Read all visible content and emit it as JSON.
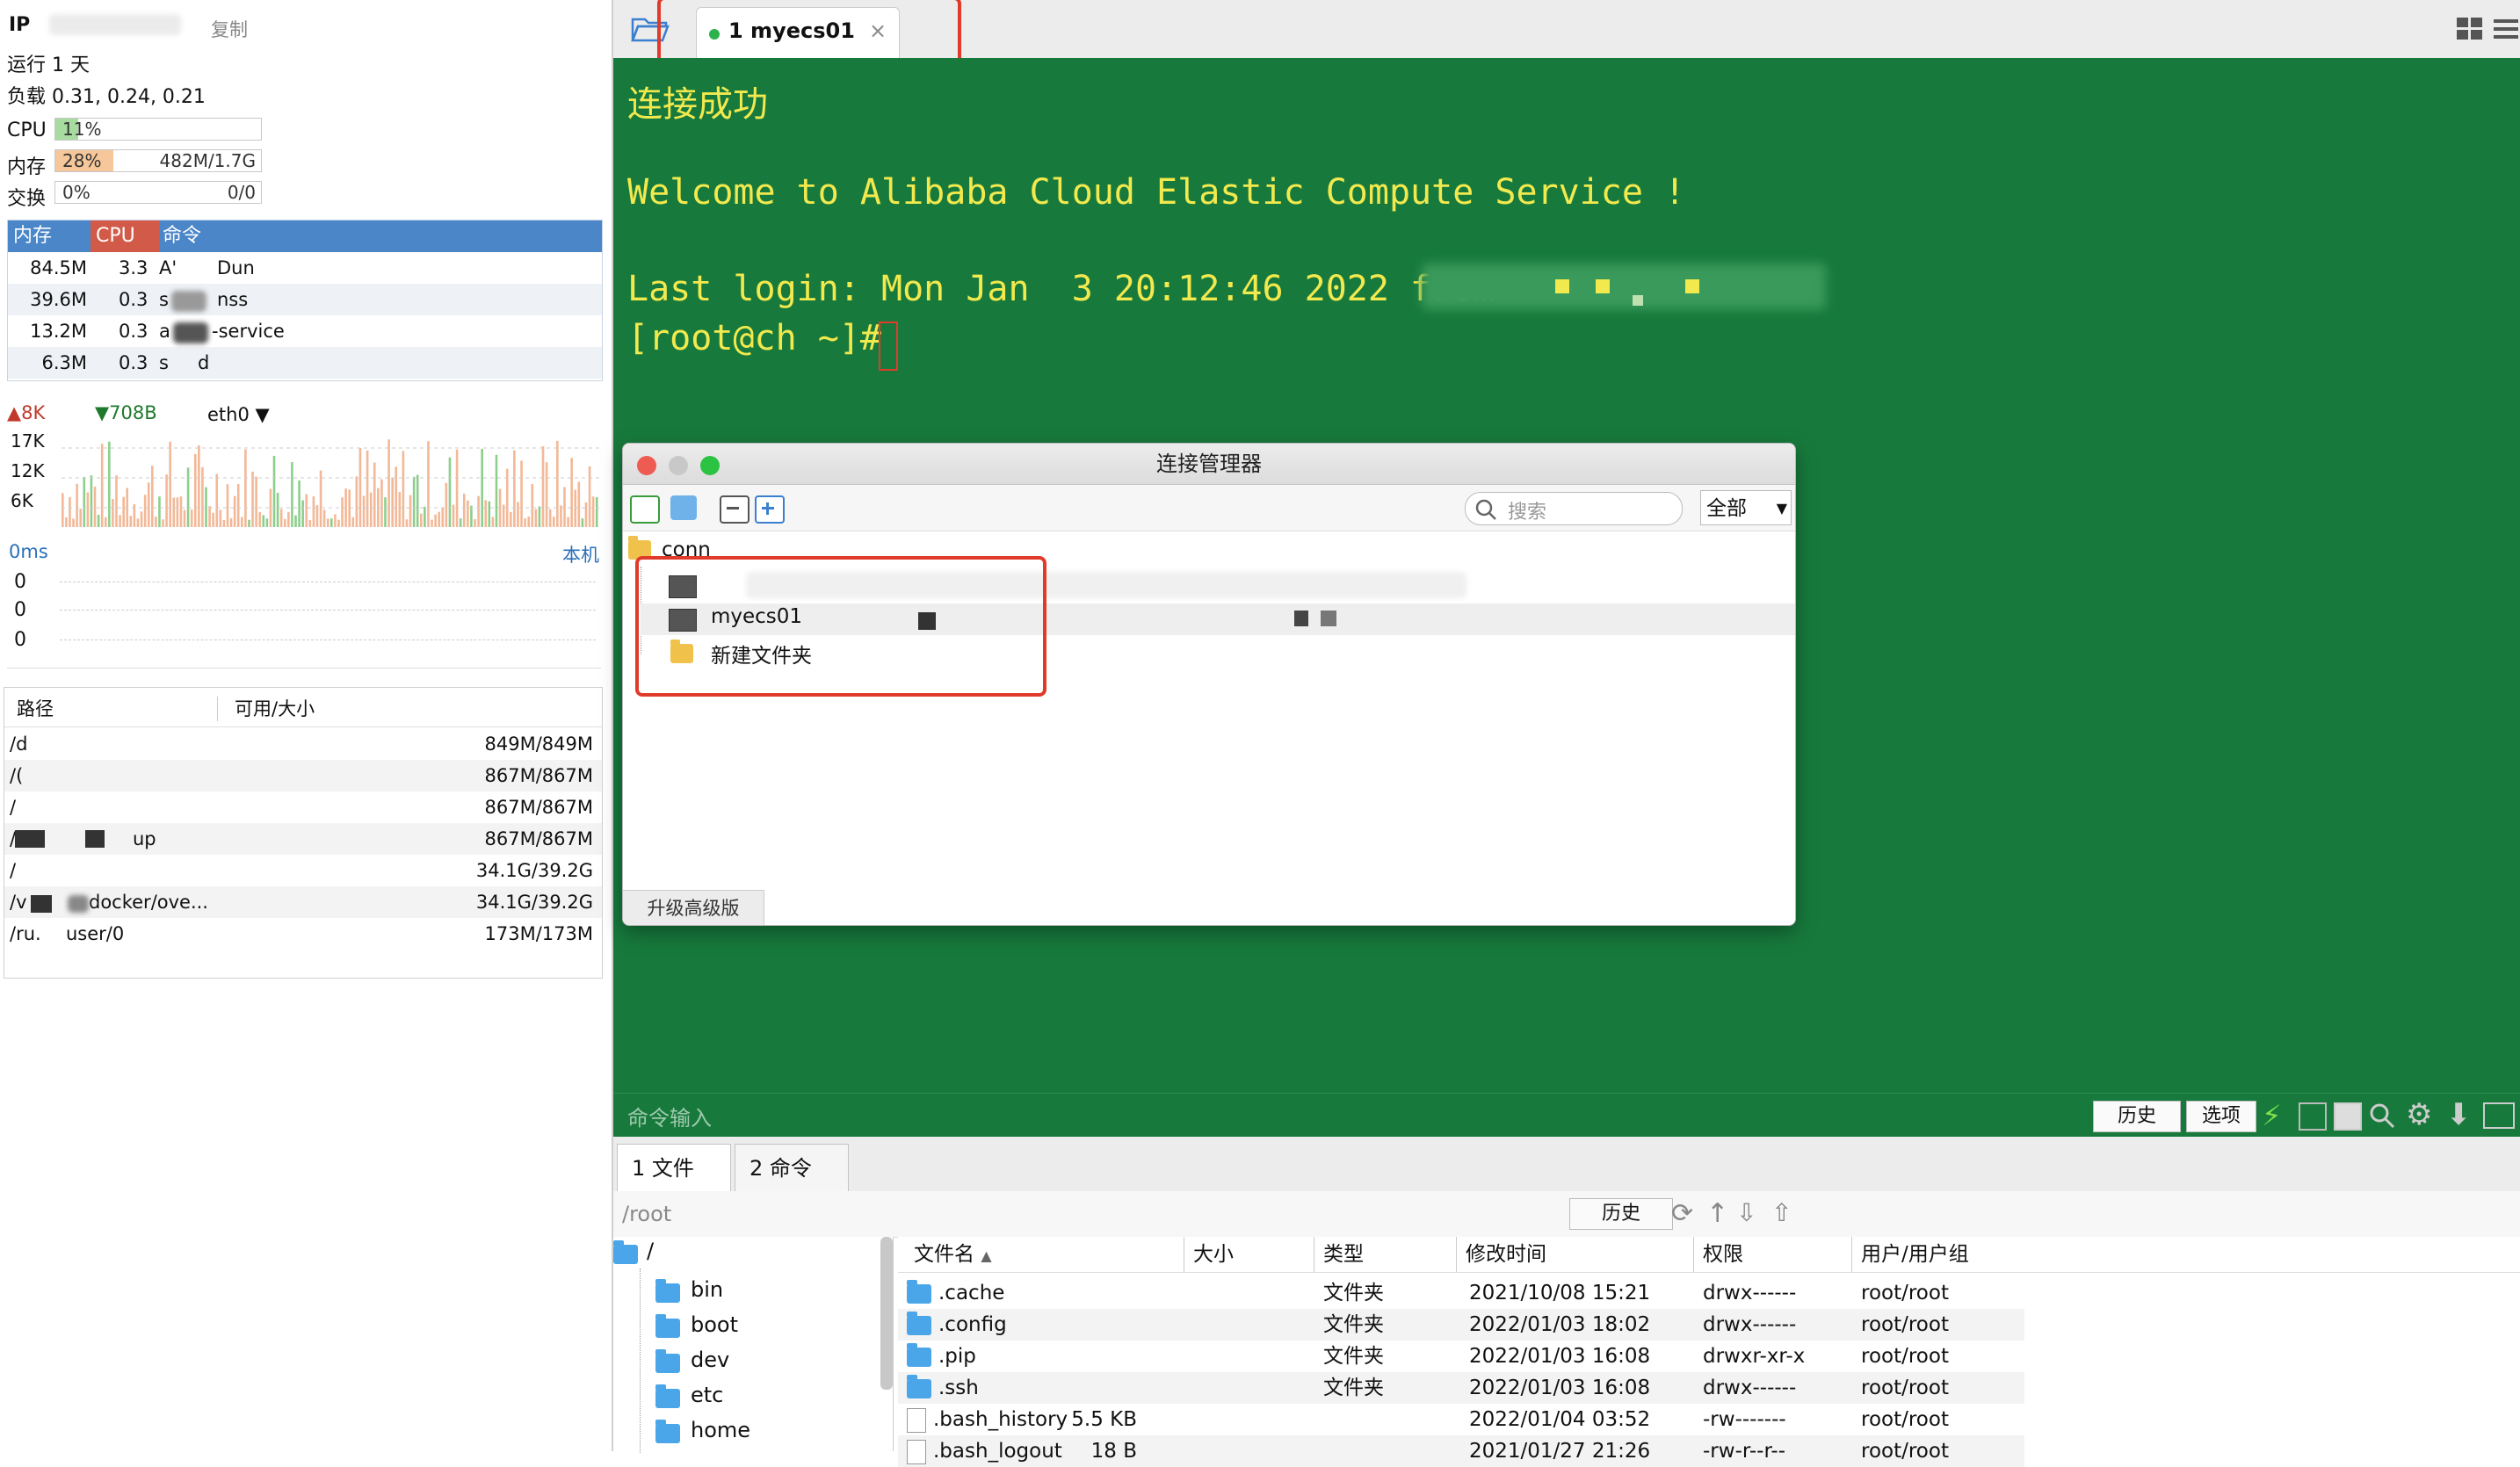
{
  "left": {
    "ip_label": "IP",
    "copy_label": "复制",
    "uptime": "运行 1 天",
    "load": "负载 0.31, 0.24, 0.21",
    "cpu": {
      "label": "CPU",
      "text": "11%",
      "fraction": 0.11
    },
    "mem": {
      "label": "内存",
      "text": "28%",
      "fraction": 0.28,
      "amount": "482M/1.7G"
    },
    "swap": {
      "label": "交换",
      "text": "0%",
      "fraction": 0.0,
      "amount": "0/0"
    },
    "proc_headers": [
      "内存",
      "CPU",
      "命令"
    ],
    "processes": [
      {
        "mem": "84.5M",
        "cpu": "3.3",
        "cmd": "A'",
        "cmd2": "Dun"
      },
      {
        "mem": "39.6M",
        "cpu": "0.3",
        "cmd": "s",
        "cmd2": "nss"
      },
      {
        "mem": "13.2M",
        "cpu": "0.3",
        "cmd": "a",
        "cmd2": "-service"
      },
      {
        "mem": "6.3M",
        "cpu": "0.3",
        "cmd": "s",
        "cmd2": "d"
      }
    ],
    "net": {
      "up": "8K",
      "down": "708B",
      "iface": "eth0",
      "ticks": [
        "17K",
        "12K",
        "6K"
      ]
    },
    "latency": {
      "value": "0ms",
      "host": "本机",
      "rows": [
        "0",
        "0",
        "0"
      ]
    },
    "disk_headers": [
      "路径",
      "可用/大小"
    ],
    "disks": [
      {
        "path": "/d",
        "size": "849M/849M"
      },
      {
        "path": "/(",
        "size": "867M/867M"
      },
      {
        "path": "/",
        "size": "867M/867M"
      },
      {
        "path": "/",
        "path2": "up",
        "size": "867M/867M"
      },
      {
        "path": "/",
        "size": "34.1G/39.2G"
      },
      {
        "path": "/v",
        "path2": "docker/ove...",
        "size": "34.1G/39.2G"
      },
      {
        "path": "/ru.",
        "path2": "user/0",
        "size": "173M/173M"
      }
    ]
  },
  "tabbar": {
    "tab_label": "1  myecs01",
    "close": "×"
  },
  "terminal": {
    "lines": [
      "连接成功",
      "",
      "Welcome to Alibaba Cloud Elastic Compute Service !",
      "",
      "Last login: Mon Jan  3 20:12:46 2022 from",
      "[root@ch ~]# "
    ]
  },
  "conn_manager": {
    "title": "连接管理器",
    "search_placeholder": "搜索",
    "filter": "全部",
    "root": "conn",
    "items": [
      "",
      "myecs01",
      "新建文件夹"
    ],
    "upgrade": "升级高级版"
  },
  "cmdbar": {
    "placeholder": "命令输入",
    "history": "历史",
    "options": "选项"
  },
  "bottom": {
    "tabs": [
      "1 文件",
      "2 命令"
    ],
    "path": "/root",
    "history": "历史",
    "tree_root": "/",
    "tree": [
      "bin",
      "boot",
      "dev",
      "etc",
      "home"
    ],
    "columns": [
      "文件名",
      "大小",
      "类型",
      "修改时间",
      "权限",
      "用户/用户组"
    ],
    "files": [
      {
        "name": ".cache",
        "size": "",
        "type": "文件夹",
        "mtime": "2021/10/08 15:21",
        "perm": "drwx------",
        "owner": "root/root",
        "kind": "folder"
      },
      {
        "name": ".config",
        "size": "",
        "type": "文件夹",
        "mtime": "2022/01/03 18:02",
        "perm": "drwx------",
        "owner": "root/root",
        "kind": "folder"
      },
      {
        "name": ".pip",
        "size": "",
        "type": "文件夹",
        "mtime": "2022/01/03 16:08",
        "perm": "drwxr-xr-x",
        "owner": "root/root",
        "kind": "folder"
      },
      {
        "name": ".ssh",
        "size": "",
        "type": "文件夹",
        "mtime": "2022/01/03 16:08",
        "perm": "drwx------",
        "owner": "root/root",
        "kind": "folder"
      },
      {
        "name": ".bash_history",
        "size": "5.5 KB",
        "type": "",
        "mtime": "2022/01/04 03:52",
        "perm": "-rw-------",
        "owner": "root/root",
        "kind": "file"
      },
      {
        "name": ".bash_logout",
        "size": "18 B",
        "type": "",
        "mtime": "2021/01/27 21:26",
        "perm": "-rw-r--r--",
        "owner": "root/root",
        "kind": "file"
      }
    ]
  },
  "colors": {
    "terminal_bg": "#177a3c",
    "terminal_fg": "#f2e94e",
    "accent": "#4a86c8",
    "highlight": "#e03a2a"
  }
}
